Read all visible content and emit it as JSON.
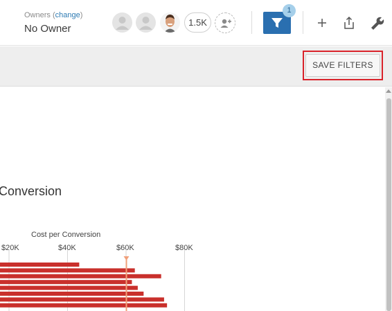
{
  "header": {
    "owners_label_prefix": "Owners (",
    "owners_change_link": "change",
    "owners_label_suffix": ")",
    "owner_value": "No Owner",
    "follower_count": "1.5K",
    "filter_badge_count": "1",
    "icons": {
      "filter": "filter-icon",
      "add": "plus-icon",
      "share": "share-icon",
      "settings": "wrench-icon",
      "add_person": "add-person-icon"
    }
  },
  "toolbar": {
    "save_filters_label": "SAVE FILTERS"
  },
  "chart": {
    "title_visible": "Conversion"
  },
  "chart_data": {
    "type": "bar",
    "orientation": "horizontal",
    "title": "Conversion",
    "xlabel": "Cost per Conversion",
    "x_ticks": [
      "$20K",
      "$40K",
      "$60K",
      "$80K"
    ],
    "xlim": [
      0,
      80000
    ],
    "reference_line": 60000,
    "bar_color": "#c9302c",
    "values": [
      44000,
      63000,
      72000,
      62000,
      64000,
      66000,
      73000,
      74000
    ]
  },
  "colors": {
    "accent": "#2a6fb0",
    "highlight": "#d9222a",
    "bar": "#c9302c",
    "reference": "#f0a07a"
  }
}
